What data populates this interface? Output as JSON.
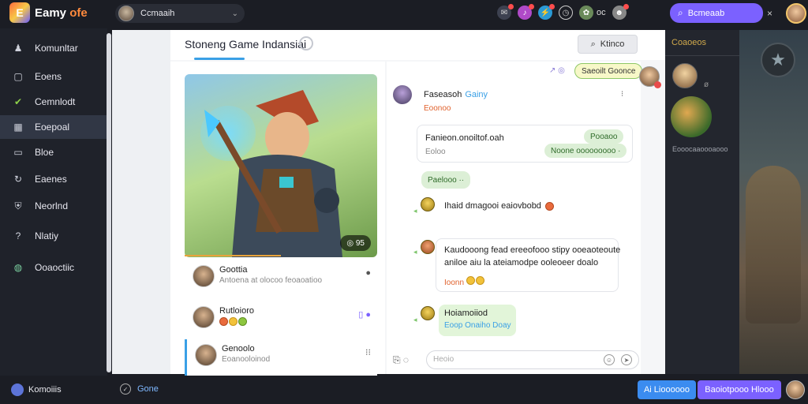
{
  "app": {
    "logo_mark": "E",
    "name": "Eamy",
    "name_suffix": " ofe"
  },
  "topbar": {
    "channel_select": "Ccmaaih",
    "label": "ос",
    "search_button": "Bcmeaab",
    "close": "×"
  },
  "sidebar": {
    "items": [
      {
        "label": "Komunltar",
        "icon": "people-icon"
      },
      {
        "label": "Eoens",
        "icon": "square-icon"
      },
      {
        "label": "Cemnlodt",
        "icon": "check-icon"
      },
      {
        "label": "Eoepoal",
        "icon": "grid-icon"
      },
      {
        "label": "Bloe",
        "icon": "doc-icon"
      },
      {
        "label": "Eaenes",
        "icon": "refresh-icon"
      },
      {
        "label": "Neorlnd",
        "icon": "shield-icon"
      },
      {
        "label": "Nlatiy",
        "icon": "help-icon"
      },
      {
        "label": "Ooaoctiic",
        "icon": "globe-icon"
      }
    ],
    "active_index": 3
  },
  "header": {
    "title": "Stoneng Game Indansiai",
    "button": "Ktinco"
  },
  "hero": {
    "badge": "95"
  },
  "list": [
    {
      "name": "Goottia",
      "sub": "Antoena at olocoo feoaoatioo",
      "icon": "●"
    },
    {
      "name": "Rutloioro",
      "sub": "",
      "icon": "▯ ●"
    },
    {
      "name": "Genoolo",
      "sub": "Eoanooloinod",
      "icon": "⁝⁝"
    }
  ],
  "chat": {
    "pill_top": "Saeoilt Goonce",
    "pill_icons": "↗ ◎",
    "name": "Faseasoh",
    "tag": "Gainy",
    "sub": "Eoonoo",
    "menu": "⁝",
    "card1": {
      "title": "Fanieon.onoiltof.oah",
      "sub": "Eoloo",
      "chip1": "Pooaoo",
      "chip2": "Noone ooooooooo ·"
    },
    "chip_row": "Paelooo ··",
    "msg1": "Ihaid dmagooi eaiovbobd",
    "msg2_line1": "Kaudooong fead ereeofooo stipy ooeaoteoute",
    "msg2_line2": "aniloe aiu la ateiamodpe ooleoeer doalo",
    "msg2_tag": "Ioonn",
    "msg3_name": "Hoiamoiiod",
    "msg3_sub": "Eoop Onaiho Doay",
    "composer_placeholder": "Heoio"
  },
  "rpanel": {
    "head": "Coaoeos",
    "num": "ø",
    "caption": "Eooocaaoooaooo"
  },
  "bottombar": {
    "user": "Komoiiis",
    "mid": "Gone",
    "btn1": "Ai Lioooooo",
    "btn2": "Baoiotpooo Hlooo"
  }
}
